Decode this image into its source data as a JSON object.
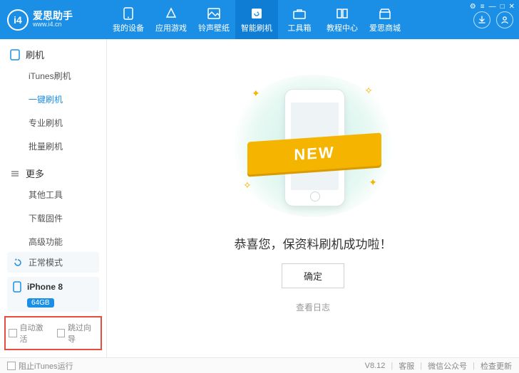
{
  "brand": {
    "cn": "爱思助手",
    "en": "www.i4.cn",
    "logo": "i4"
  },
  "tabs": [
    {
      "label": "我的设备"
    },
    {
      "label": "应用游戏"
    },
    {
      "label": "铃声壁纸"
    },
    {
      "label": "智能刷机"
    },
    {
      "label": "工具箱"
    },
    {
      "label": "教程中心"
    },
    {
      "label": "爱思商城"
    }
  ],
  "active_tab_index": 3,
  "sidebar": {
    "sections": [
      {
        "title": "刷机",
        "items": [
          "iTunes刷机",
          "一键刷机",
          "专业刷机",
          "批量刷机"
        ],
        "active_index": 1
      },
      {
        "title": "更多",
        "items": [
          "其他工具",
          "下载固件",
          "高级功能"
        ]
      }
    ],
    "mode": "正常模式",
    "device": {
      "name": "iPhone 8",
      "badge": "64GB"
    },
    "opts": [
      "自动激活",
      "跳过向导"
    ]
  },
  "main": {
    "ribbon": "NEW",
    "success": "恭喜您，保资料刷机成功啦！",
    "ok": "确定",
    "log": "查看日志"
  },
  "footer": {
    "block_itunes": "阻止iTunes运行",
    "version": "V8.12",
    "links": [
      "客服",
      "微信公众号",
      "检查更新"
    ]
  },
  "win": {
    "items": [
      "⚙",
      "≡",
      "—",
      "□",
      "✕"
    ]
  }
}
